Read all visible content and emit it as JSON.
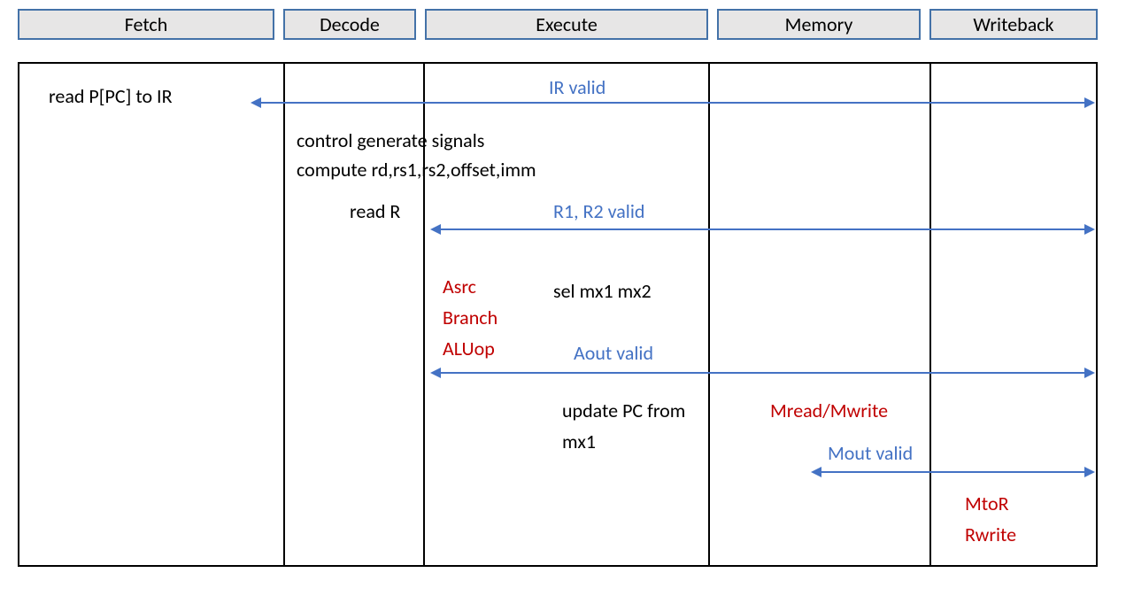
{
  "stages": {
    "fetch": "Fetch",
    "decode": "Decode",
    "execute": "Execute",
    "memory": "Memory",
    "writeback": "Writeback"
  },
  "fetch": {
    "action": "read P[PC] to IR"
  },
  "signals": {
    "ir_valid": "IR valid",
    "r1_r2_valid": "R1, R2 valid",
    "aout_valid": "Aout valid",
    "mout_valid": "Mout valid"
  },
  "decode": {
    "line1": "control generate signals",
    "line2": "compute rd,rs1,rs2,offset,imm",
    "readR": "read R"
  },
  "execute": {
    "asrc": "Asrc",
    "branch": "Branch",
    "aluop": "ALUop",
    "sel": "sel mx1 mx2",
    "updatepc1": "update PC from",
    "updatepc2": "mx1"
  },
  "memory": {
    "mread_mwrite": "Mread/Mwrite"
  },
  "writeback": {
    "mtor": "MtoR",
    "rwrite": "Rwrite"
  }
}
